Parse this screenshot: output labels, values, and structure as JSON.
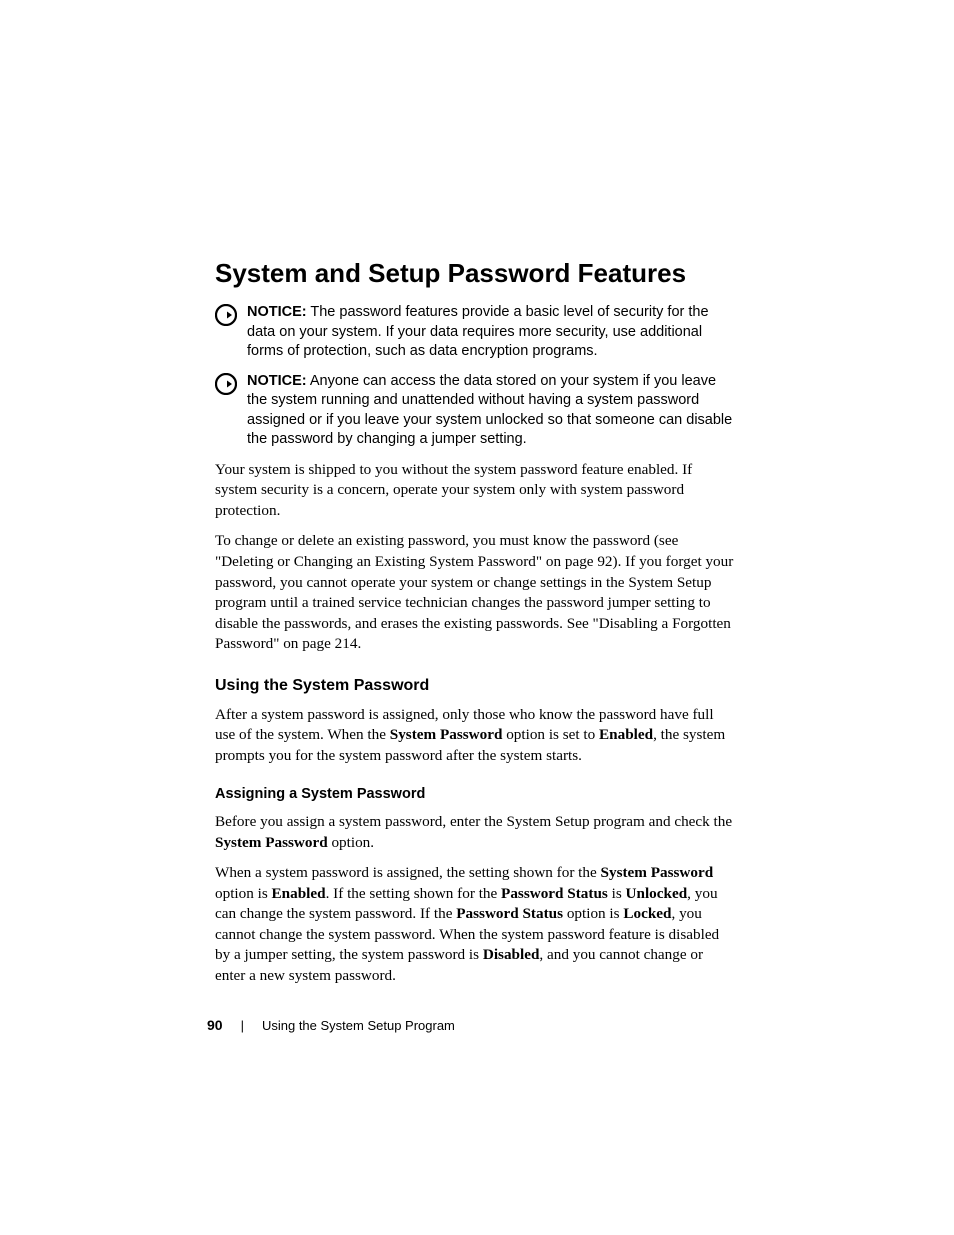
{
  "heading": "System and Setup Password Features",
  "notice1": {
    "label": "NOTICE:",
    "text": " The password features provide a basic level of security for the data on your system. If your data requires more security, use additional forms of protection, such as data encryption programs."
  },
  "notice2": {
    "label": "NOTICE:",
    "text": " Anyone can access the data stored on your system if you leave the system running and unattended without having a system password assigned or if you leave your system unlocked so that someone can disable the password by changing a jumper setting."
  },
  "para1": "Your system is shipped to you without the system password feature enabled. If system security is a concern, operate your system only with system password protection.",
  "para2": "To change or delete an existing password, you must know the password (see \"Deleting or Changing an Existing System Password\" on page 92). If you forget your password, you cannot operate your system or change settings in the System Setup program until a trained service technician changes the password jumper setting to disable the passwords, and erases the existing passwords. See \"Disabling a Forgotten Password\" on page 214.",
  "h2_using": "Using the System Password",
  "para3_pre": "After a system password is assigned, only those who know the password have full use of the system. When the ",
  "para3_b1": "System Password",
  "para3_mid": " option is set to ",
  "para3_b2": "Enabled",
  "para3_post": ", the system prompts you for the system password after the system starts.",
  "h3_assigning": "Assigning a System Password",
  "para4_pre": "Before you assign a system password, enter the System Setup program and check the ",
  "para4_b1": "System Password",
  "para4_post": " option.",
  "para5_pre": "When a system password is assigned, the setting shown for the ",
  "para5_b1": "System Password",
  "para5_m1": " option is ",
  "para5_b2": "Enabled",
  "para5_m2": ". If the setting shown for the ",
  "para5_b3": "Password Status",
  "para5_m3": " is ",
  "para5_b4": "Unlocked",
  "para5_m4": ", you can change the system password. If the ",
  "para5_b5": "Password Status",
  "para5_m5": " option is ",
  "para5_b6": "Locked",
  "para5_m6": ", you cannot change the system password. When the system password feature is disabled by a jumper setting, the system password is ",
  "para5_b7": "Disabled",
  "para5_post": ", and you cannot change or enter a new system password.",
  "footer": {
    "page": "90",
    "divider": "|",
    "section": "Using the System Setup Program"
  }
}
